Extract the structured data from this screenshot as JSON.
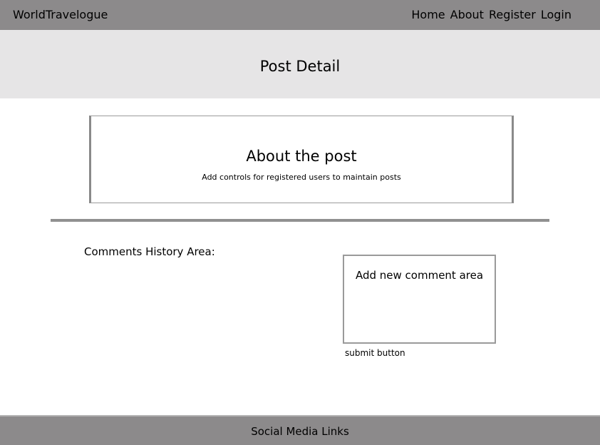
{
  "navbar": {
    "brand": "WorldTravelogue",
    "links": [
      "Home",
      "About",
      "Register",
      "Login"
    ]
  },
  "page_title": "Post Detail",
  "post_box": {
    "title": "About the post",
    "description": "Add controls for registered users to maintain posts"
  },
  "comments": {
    "history_label": "Comments History Area:",
    "new_comment_label": "Add new comment area",
    "submit_label": "submit button"
  },
  "footer": {
    "text": "Social Media Links"
  }
}
